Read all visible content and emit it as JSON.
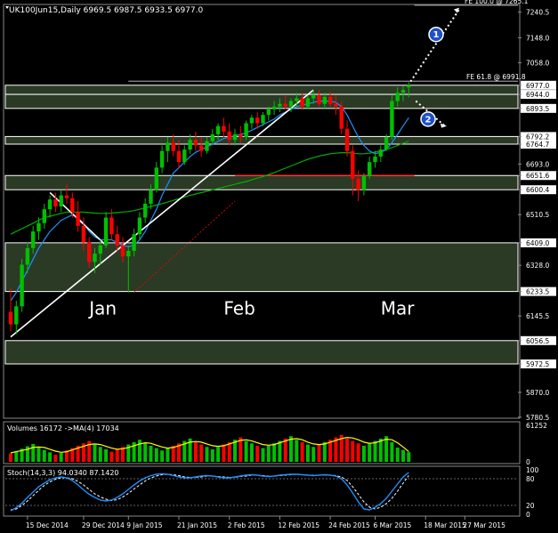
{
  "header": {
    "symbol_line": "UK100Jun15,Daily  6969.5 6987.5 6933.5 6977.0"
  },
  "colors": {
    "bg": "#000000",
    "bull": "#00c000",
    "bear": "#ff0000",
    "zone_fill": "#2a3a24",
    "zone_border": "#ffffff",
    "ma_fast": "#1e90ff",
    "ma_slow": "#00b000",
    "hline_red": "#ff3030",
    "vol_ma": "#ffff00",
    "stoch_main": "#1e90ff",
    "stoch_signal": "#ffffff",
    "text": "#ffffff"
  },
  "chart_data": [
    {
      "type": "candlestick",
      "ylim": [
        5780.0,
        7265.0
      ],
      "y_axis_labels": [
        "7240.5",
        "7148.0",
        "7058.0",
        "6977.0",
        "6944.0",
        "6893.5",
        "6792.2",
        "6764.7",
        "6693.0",
        "6651.6",
        "6600.4",
        "6510.5",
        "6409.0",
        "6328.0",
        "6233.5",
        "6145.5",
        "6056.5",
        "5972.5",
        "5870.0",
        "5780.5"
      ],
      "highlighted_prices": [
        "6977.0",
        "6944.0",
        "6893.5",
        "6792.2",
        "6764.7",
        "6651.6",
        "6600.4",
        "6409.0",
        "6233.5",
        "6056.5",
        "5972.5"
      ],
      "month_labels": [
        {
          "label": "Jan",
          "bar": 14
        },
        {
          "label": "Feb",
          "bar": 38
        },
        {
          "label": "Mar",
          "bar": 66
        }
      ],
      "x_tick_labels": [
        {
          "label": "15 Dec 2014",
          "bar": 3
        },
        {
          "label": "29 Dec 2014",
          "bar": 13
        },
        {
          "label": "9 Jan 2015",
          "bar": 21
        },
        {
          "label": "21 Jan 2015",
          "bar": 30
        },
        {
          "label": "2 Feb 2015",
          "bar": 39
        },
        {
          "label": "12 Feb 2015",
          "bar": 48
        },
        {
          "label": "24 Feb 2015",
          "bar": 57
        },
        {
          "label": "6 Mar 2015",
          "bar": 65
        },
        {
          "label": "18 Mar 2015",
          "bar": 74
        },
        {
          "label": "27 Mar 2015",
          "bar": 81
        }
      ],
      "zones": [
        [
          6944.0,
          6977.0
        ],
        [
          6893.5,
          6944.0
        ],
        [
          6764.7,
          6792.2
        ],
        [
          6600.4,
          6651.6
        ],
        [
          6233.5,
          6409.0
        ],
        [
          5972.5,
          6056.5
        ]
      ],
      "fibo_labels": [
        {
          "label": "FE 100.0 @ 7265.1",
          "price": 7265.1
        },
        {
          "label": "FE 61.8 @ 6991.8",
          "price": 6991.8
        }
      ],
      "red_hline": 6651.6,
      "projection_markers": [
        "1",
        "2"
      ],
      "candles": [
        [
          6160,
          6245,
          6090,
          6115
        ],
        [
          6115,
          6200,
          6080,
          6180
        ],
        [
          6180,
          6350,
          6160,
          6330
        ],
        [
          6330,
          6410,
          6300,
          6390
        ],
        [
          6390,
          6470,
          6370,
          6450
        ],
        [
          6450,
          6500,
          6420,
          6480
        ],
        [
          6480,
          6550,
          6460,
          6530
        ],
        [
          6530,
          6580,
          6500,
          6565
        ],
        [
          6565,
          6590,
          6520,
          6540
        ],
        [
          6540,
          6600,
          6520,
          6580
        ],
        [
          6580,
          6620,
          6550,
          6570
        ],
        [
          6570,
          6590,
          6500,
          6520
        ],
        [
          6520,
          6560,
          6450,
          6470
        ],
        [
          6470,
          6500,
          6380,
          6410
        ],
        [
          6410,
          6430,
          6320,
          6340
        ],
        [
          6340,
          6390,
          6300,
          6370
        ],
        [
          6370,
          6420,
          6330,
          6400
        ],
        [
          6400,
          6520,
          6390,
          6500
        ],
        [
          6500,
          6530,
          6420,
          6440
        ],
        [
          6440,
          6470,
          6380,
          6400
        ],
        [
          6400,
          6430,
          6340,
          6360
        ],
        [
          6360,
          6400,
          6230,
          6380
        ],
        [
          6380,
          6460,
          6360,
          6440
        ],
        [
          6440,
          6520,
          6420,
          6500
        ],
        [
          6500,
          6570,
          6480,
          6550
        ],
        [
          6550,
          6620,
          6530,
          6600
        ],
        [
          6600,
          6700,
          6590,
          6680
        ],
        [
          6680,
          6760,
          6660,
          6740
        ],
        [
          6740,
          6790,
          6700,
          6770
        ],
        [
          6770,
          6800,
          6720,
          6740
        ],
        [
          6740,
          6780,
          6680,
          6700
        ],
        [
          6700,
          6760,
          6690,
          6745
        ],
        [
          6745,
          6800,
          6730,
          6780
        ],
        [
          6780,
          6810,
          6740,
          6760
        ],
        [
          6760,
          6790,
          6720,
          6740
        ],
        [
          6740,
          6790,
          6730,
          6775
        ],
        [
          6775,
          6820,
          6760,
          6800
        ],
        [
          6800,
          6840,
          6780,
          6830
        ],
        [
          6830,
          6860,
          6790,
          6810
        ],
        [
          6810,
          6840,
          6760,
          6780
        ],
        [
          6780,
          6820,
          6760,
          6800
        ],
        [
          6800,
          6830,
          6770,
          6790
        ],
        [
          6790,
          6850,
          6780,
          6840
        ],
        [
          6840,
          6870,
          6820,
          6860
        ],
        [
          6860,
          6880,
          6820,
          6840
        ],
        [
          6840,
          6880,
          6830,
          6870
        ],
        [
          6870,
          6900,
          6850,
          6890
        ],
        [
          6890,
          6920,
          6870,
          6900
        ],
        [
          6900,
          6930,
          6880,
          6910
        ],
        [
          6910,
          6940,
          6890,
          6900
        ],
        [
          6900,
          6930,
          6880,
          6920
        ],
        [
          6920,
          6950,
          6900,
          6930
        ],
        [
          6930,
          6950,
          6890,
          6900
        ],
        [
          6900,
          6940,
          6890,
          6930
        ],
        [
          6930,
          6960,
          6910,
          6940
        ],
        [
          6940,
          6960,
          6900,
          6910
        ],
        [
          6910,
          6950,
          6890,
          6935
        ],
        [
          6935,
          6955,
          6900,
          6910
        ],
        [
          6910,
          6940,
          6870,
          6900
        ],
        [
          6900,
          6920,
          6800,
          6820
        ],
        [
          6820,
          6850,
          6720,
          6740
        ],
        [
          6740,
          6760,
          6580,
          6640
        ],
        [
          6640,
          6670,
          6560,
          6600
        ],
        [
          6600,
          6660,
          6580,
          6650
        ],
        [
          6650,
          6720,
          6640,
          6700
        ],
        [
          6700,
          6740,
          6680,
          6720
        ],
        [
          6720,
          6760,
          6700,
          6745
        ],
        [
          6745,
          6800,
          6740,
          6790
        ],
        [
          6790,
          6940,
          6780,
          6920
        ],
        [
          6920,
          6970,
          6900,
          6950
        ],
        [
          6950,
          6975,
          6920,
          6960
        ],
        [
          6969.5,
          6987.5,
          6933.5,
          6977.0
        ]
      ],
      "ma_fast": [
        6200,
        6230,
        6270,
        6310,
        6350,
        6390,
        6420,
        6450,
        6470,
        6490,
        6500,
        6510,
        6500,
        6480,
        6450,
        6430,
        6420,
        6420,
        6420,
        6410,
        6400,
        6395,
        6400,
        6420,
        6450,
        6490,
        6530,
        6580,
        6620,
        6660,
        6680,
        6700,
        6720,
        6735,
        6745,
        6755,
        6765,
        6775,
        6785,
        6790,
        6795,
        6800,
        6805,
        6815,
        6825,
        6835,
        6845,
        6855,
        6870,
        6880,
        6890,
        6900,
        6905,
        6910,
        6915,
        6920,
        6920,
        6920,
        6915,
        6900,
        6870,
        6830,
        6790,
        6760,
        6740,
        6730,
        6735,
        6745,
        6770,
        6800,
        6830,
        6860
      ],
      "ma_slow": [
        6440,
        6450,
        6460,
        6470,
        6480,
        6490,
        6500,
        6505,
        6510,
        6515,
        6520,
        6520,
        6520,
        6520,
        6518,
        6516,
        6515,
        6515,
        6516,
        6518,
        6520,
        6522,
        6525,
        6530,
        6535,
        6540,
        6545,
        6550,
        6556,
        6562,
        6568,
        6574,
        6580,
        6585,
        6590,
        6595,
        6600,
        6605,
        6610,
        6615,
        6620,
        6625,
        6630,
        6636,
        6642,
        6648,
        6655,
        6662,
        6670,
        6678,
        6686,
        6694,
        6702,
        6710,
        6716,
        6722,
        6726,
        6730,
        6732,
        6734,
        6734,
        6732,
        6730,
        6730,
        6732,
        6736,
        6740,
        6746,
        6752,
        6760,
        6768,
        6776
      ],
      "trendlines": [
        {
          "from": [
            0,
            6070
          ],
          "to": [
            54,
            6960
          ],
          "color": "#ffffff"
        },
        {
          "from": [
            7,
            6590
          ],
          "to": [
            17,
            6400
          ],
          "color": "#ffffff"
        }
      ]
    },
    {
      "type": "bar",
      "title": "Volumes 16172  ->MA(4) 17034",
      "y_axis_labels": [
        "61252",
        "0"
      ],
      "ylim": [
        0,
        61252
      ],
      "values": [
        14000,
        18000,
        22000,
        26000,
        30000,
        24000,
        20000,
        16000,
        12000,
        15000,
        19000,
        23000,
        27000,
        31000,
        35000,
        29000,
        25000,
        21000,
        17000,
        21000,
        25000,
        29000,
        33000,
        37000,
        31000,
        27000,
        23000,
        19000,
        23000,
        27000,
        31000,
        35000,
        39000,
        33000,
        29000,
        25000,
        21000,
        25000,
        29000,
        33000,
        37000,
        41000,
        35000,
        31000,
        27000,
        23000,
        27000,
        31000,
        35000,
        39000,
        43000,
        37000,
        33000,
        29000,
        25000,
        29000,
        33000,
        37000,
        41000,
        45000,
        39000,
        35000,
        31000,
        27000,
        31000,
        35000,
        39000,
        43000,
        33000,
        24000,
        20000,
        16172
      ],
      "ma4": [
        15000,
        17000,
        19000,
        21000,
        24000,
        25000,
        24000,
        21000,
        18000,
        16000,
        17000,
        20000,
        23000,
        26000,
        29000,
        30000,
        29000,
        26000,
        23000,
        21000,
        22000,
        24000,
        27000,
        30000,
        32000,
        31000,
        28000,
        25000,
        23000,
        24000,
        27000,
        30000,
        33000,
        34000,
        33000,
        30000,
        27000,
        26000,
        27000,
        30000,
        33000,
        36000,
        37000,
        35000,
        32000,
        29000,
        28000,
        29000,
        32000,
        35000,
        38000,
        39000,
        37000,
        33000,
        30000,
        29000,
        30000,
        33000,
        36000,
        39000,
        41000,
        40000,
        37000,
        33000,
        31000,
        32000,
        35000,
        38000,
        37000,
        32000,
        25000,
        17034
      ]
    },
    {
      "type": "line",
      "title": "Stoch(14,3,3) 94.0340 87.1420",
      "y_axis_labels": [
        "100",
        "80",
        "20",
        "0"
      ],
      "ylim": [
        0,
        100
      ],
      "levels": [
        80,
        20
      ],
      "main": [
        8,
        15,
        25,
        38,
        50,
        62,
        70,
        78,
        82,
        84,
        82,
        76,
        66,
        55,
        45,
        38,
        32,
        30,
        32,
        38,
        46,
        56,
        66,
        75,
        82,
        87,
        90,
        91,
        90,
        87,
        84,
        82,
        82,
        84,
        86,
        87,
        86,
        84,
        82,
        82,
        84,
        86,
        88,
        89,
        88,
        86,
        85,
        86,
        88,
        89,
        90,
        90,
        89,
        88,
        87,
        88,
        89,
        88,
        86,
        80,
        66,
        48,
        28,
        12,
        10,
        16,
        24,
        36,
        52,
        68,
        84,
        94.034
      ],
      "signal": [
        10,
        12,
        20,
        30,
        42,
        54,
        65,
        73,
        79,
        82,
        82,
        80,
        74,
        66,
        56,
        46,
        39,
        34,
        31,
        33,
        39,
        47,
        57,
        66,
        75,
        82,
        86,
        89,
        90,
        89,
        87,
        84,
        83,
        83,
        84,
        86,
        86,
        85,
        84,
        83,
        83,
        85,
        86,
        88,
        88,
        87,
        86,
        86,
        87,
        88,
        89,
        90,
        89,
        88,
        88,
        88,
        88,
        88,
        87,
        84,
        76,
        62,
        45,
        28,
        16,
        12,
        16,
        24,
        36,
        52,
        70,
        87.142
      ]
    }
  ]
}
